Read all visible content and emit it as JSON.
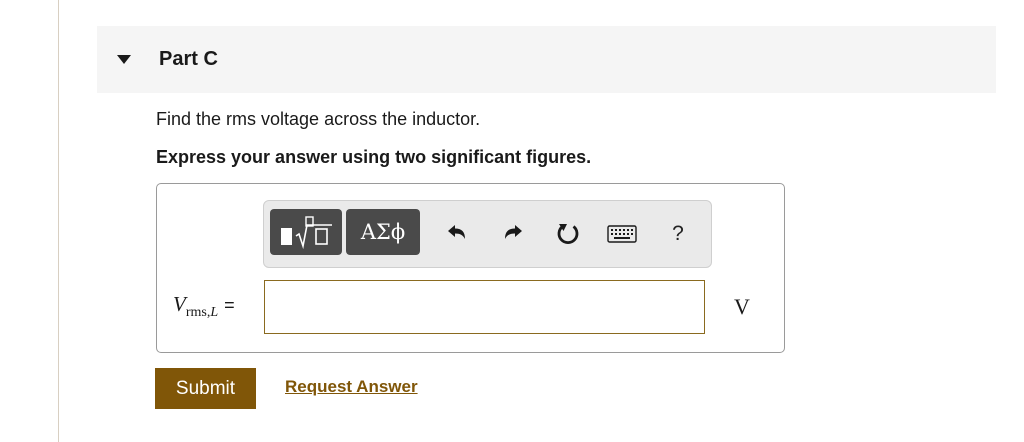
{
  "part": {
    "title": "Part C",
    "toggle_icon": "caret-down-icon"
  },
  "question": {
    "text": "Find the rms voltage across the inductor.",
    "instruction": "Express your answer using two significant figures."
  },
  "toolbar": {
    "templates_icon": "math-templates-icon",
    "greek_label": "ΑΣϕ",
    "undo_icon": "undo-icon",
    "redo_icon": "redo-icon",
    "reset_icon": "reset-icon",
    "keyboard_icon": "keyboard-icon",
    "help_label": "?"
  },
  "answer": {
    "symbol": "V",
    "subscript": "rms,",
    "subscript_var": "L",
    "equals": "=",
    "value": "",
    "unit": "V"
  },
  "actions": {
    "submit_label": "Submit",
    "request_label": "Request Answer"
  },
  "colors": {
    "accent": "#805608",
    "toolbar_button": "#4a4a4a",
    "header_bg": "#f5f5f5"
  }
}
